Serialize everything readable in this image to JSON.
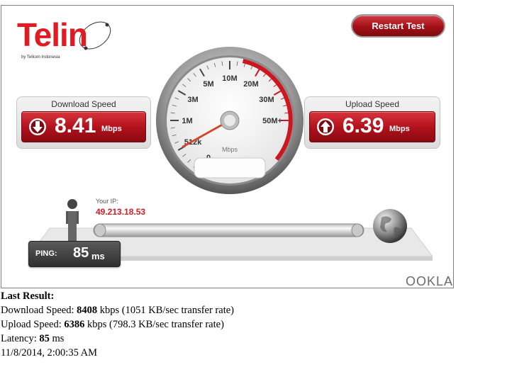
{
  "logo": {
    "word": "Telin",
    "tagline": "by Telkom Indonesia"
  },
  "restart_label": "Restart Test",
  "download": {
    "title": "Download Speed",
    "value": "8.41",
    "unit": "Mbps"
  },
  "upload": {
    "title": "Upload Speed",
    "value": "6.39",
    "unit": "Mbps"
  },
  "gauge": {
    "ticks": [
      "0",
      "512k",
      "1M",
      "3M",
      "5M",
      "10M",
      "20M",
      "30M",
      "50M+"
    ],
    "unit": "Mbps"
  },
  "ip": {
    "label": "Your IP:",
    "value": "49.213.18.53"
  },
  "ping": {
    "label": "PING:",
    "value": "85",
    "unit": "ms"
  },
  "brand": "OOKLA",
  "results": {
    "heading": "Last Result:",
    "download_prefix": "Download Speed: ",
    "download_kbps": "8408",
    "download_suffix": " kbps (1051 KB/sec transfer rate)",
    "upload_prefix": "Upload Speed: ",
    "upload_kbps": "6386",
    "upload_suffix": " kbps (798.3 KB/sec transfer rate)",
    "latency_prefix": "Latency: ",
    "latency_ms": "85",
    "latency_suffix": " ms",
    "timestamp": "11/8/2014, 2:00:35 AM"
  },
  "colors": {
    "accent": "#e21b23",
    "panel_red": "#b0101a",
    "ping_bg": "#3a3a3a"
  }
}
